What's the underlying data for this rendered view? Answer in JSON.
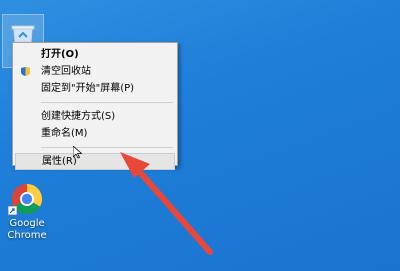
{
  "desktop": {
    "icons": [
      {
        "name": "recycle-bin",
        "label": ""
      },
      {
        "name": "google-chrome",
        "label": "Google Chrome"
      }
    ]
  },
  "context_menu": {
    "items": [
      {
        "label": "打开(O)",
        "bold": true
      },
      {
        "label": "清空回收站",
        "icon": "shield-icon"
      },
      {
        "label": "固定到\"开始\"屏幕(P)"
      },
      {
        "separator": true
      },
      {
        "label": "创建快捷方式(S)"
      },
      {
        "label": "重命名(M)"
      },
      {
        "separator": true
      },
      {
        "label": "属性(R)",
        "hovered": true
      }
    ]
  },
  "colors": {
    "desktop": "#1e7ed8",
    "menu_bg": "#f2f2f2",
    "annotation_arrow": "#e8473a"
  }
}
